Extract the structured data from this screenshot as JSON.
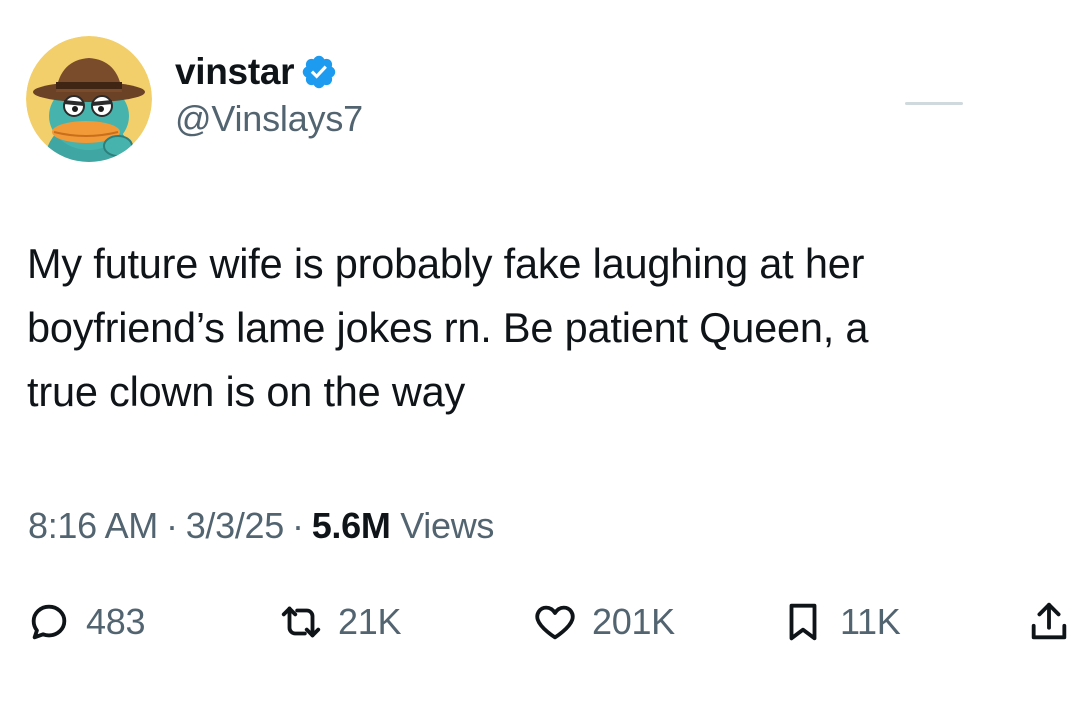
{
  "author": {
    "display_name": "vinstar",
    "handle": "@Vinslays7",
    "avatar_icon": "platypus-agent-avatar",
    "verified_icon": "verified-badge-icon",
    "verified_color": "#1d9bf0"
  },
  "tweet": {
    "text_lines": [
      "My future wife is probably fake laughing at her",
      "boyfriend’s lame jokes rn. Be patient Queen, a",
      "true clown is on the way"
    ]
  },
  "meta": {
    "time": "8:16 AM",
    "separator": "·",
    "date": "3/3/25",
    "views_count": "5.6M",
    "views_label": "Views"
  },
  "actions": {
    "replies": "483",
    "reposts": "21K",
    "likes": "201K",
    "bookmarks": "11K"
  },
  "colors": {
    "text": "#0f1419",
    "secondary": "#536471",
    "accent": "#1d9bf0"
  }
}
